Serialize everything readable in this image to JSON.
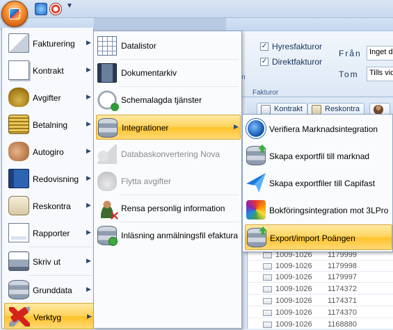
{
  "app_menu": {
    "items": [
      {
        "label": "Fakturering",
        "icon": "envelope-icon"
      },
      {
        "label": "Kontrakt",
        "icon": "contract-icon"
      },
      {
        "label": "Avgifter",
        "icon": "moneybag-icon"
      },
      {
        "label": "Betalning",
        "icon": "coins-icon"
      },
      {
        "label": "Autogiro",
        "icon": "handshake-icon"
      },
      {
        "label": "Redovisning",
        "icon": "book-icon"
      },
      {
        "label": "Reskontra",
        "icon": "scroll-icon"
      },
      {
        "label": "Rapporter",
        "icon": "report-icon"
      },
      {
        "label": "Skriv ut",
        "icon": "printer-icon"
      },
      {
        "label": "Grunddata",
        "icon": "database-icon"
      },
      {
        "label": "Verktyg",
        "icon": "tools-icon",
        "active": true
      }
    ]
  },
  "submenu": {
    "items": [
      {
        "label": "Datalistor",
        "icon": "grid-icon"
      },
      {
        "label": "Dokumentarkiv",
        "icon": "server-icon"
      },
      {
        "label": "Schemalagda tjänster",
        "icon": "clock-icon"
      },
      {
        "label": "Integrationer",
        "icon": "database-arrow-icon",
        "active": true
      },
      {
        "label": "Databaskonvertering Nova",
        "icon": "shapes-icon",
        "disabled": true
      },
      {
        "label": "Flytta avgifter",
        "icon": "moneybag-gray-icon",
        "disabled": true
      },
      {
        "label": "Rensa personlig information",
        "icon": "person-remove-icon"
      },
      {
        "label": "Inläsning anmälningsfil efaktura",
        "icon": "database-import-icon"
      }
    ]
  },
  "flyout": {
    "items": [
      {
        "label": "Verifiera Marknadsintegration",
        "icon": "globe-icon"
      },
      {
        "label": "Skapa exportfil till marknad",
        "icon": "database-upload-icon"
      },
      {
        "label": "Skapa exportfiler till Capifast",
        "icon": "paper-plane-icon"
      },
      {
        "label": "Bokföringsintegration mot 3LPro",
        "icon": "integration-3lpro-icon"
      },
      {
        "label": "Export/import Poängen",
        "icon": "database-export-icon",
        "active": true
      }
    ]
  },
  "ribbon": {
    "checkbox_hyresfakturor": "Hyresfakturor",
    "checkbox_direktfakturor": "Direktfakturor",
    "group_label": "Fakturor",
    "label_from": "Från",
    "label_to": "Tom",
    "input_from_value": "Inget da",
    "input_to_value": "Tills vid",
    "partial_group_label": "n"
  },
  "doc_tabs": {
    "contract": "Kontrakt",
    "reskontra": "Reskontra"
  },
  "grid": {
    "rows": [
      {
        "c1": "1009-1026",
        "c2": "1179999"
      },
      {
        "c1": "1009-1026",
        "c2": "1179998"
      },
      {
        "c1": "1009-1026",
        "c2": "1179997"
      },
      {
        "c1": "1009-1026",
        "c2": "1174372"
      },
      {
        "c1": "1009-1026",
        "c2": "1174371"
      },
      {
        "c1": "1009-1026",
        "c2": "1174370"
      },
      {
        "c1": "1009-1026",
        "c2": "1168880"
      }
    ]
  },
  "colors": {
    "highlight": "#ffd35a",
    "menu_border": "#8ea5c6",
    "ribbon_bg": "#dce7f5"
  }
}
